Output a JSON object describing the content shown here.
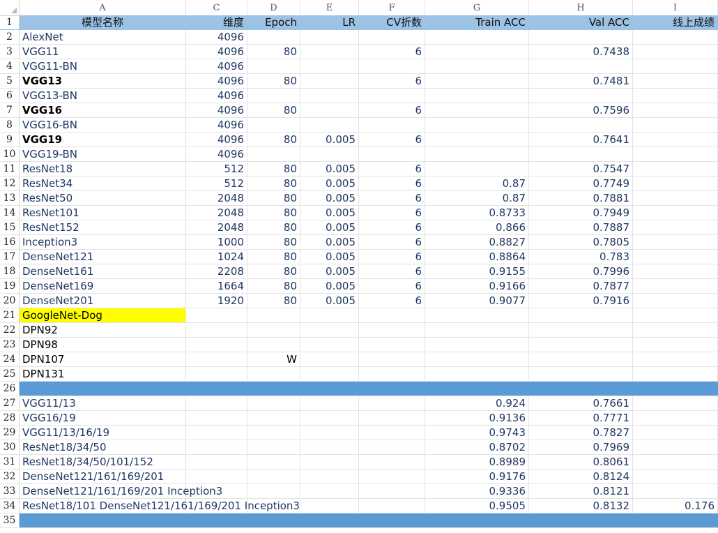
{
  "columns": [
    "A",
    "C",
    "D",
    "E",
    "F",
    "G",
    "H",
    "I"
  ],
  "header": [
    "模型名称",
    "维度",
    "Epoch",
    "LR",
    "CV折数",
    "Train ACC",
    "Val ACC",
    "线上成绩"
  ],
  "rows": [
    {
      "n": "2",
      "A": "AlexNet",
      "C": "4096",
      "D": "",
      "E": "",
      "F": "",
      "G": "",
      "H": "",
      "I": ""
    },
    {
      "n": "3",
      "A": "VGG11",
      "C": "4096",
      "D": "80",
      "E": "",
      "F": "6",
      "G": "",
      "H": "0.7438",
      "I": ""
    },
    {
      "n": "4",
      "A": "VGG11-BN",
      "C": "4096",
      "D": "",
      "E": "",
      "F": "",
      "G": "",
      "H": "",
      "I": ""
    },
    {
      "n": "5",
      "A": "VGG13",
      "C": "4096",
      "D": "80",
      "E": "",
      "F": "6",
      "G": "",
      "H": "0.7481",
      "I": ""
    },
    {
      "n": "6",
      "A": "VGG13-BN",
      "C": "4096",
      "D": "",
      "E": "",
      "F": "",
      "G": "",
      "H": "",
      "I": ""
    },
    {
      "n": "7",
      "A": "VGG16",
      "C": "4096",
      "D": "80",
      "E": "",
      "F": "6",
      "G": "",
      "H": "0.7596",
      "I": ""
    },
    {
      "n": "8",
      "A": "VGG16-BN",
      "C": "4096",
      "D": "",
      "E": "",
      "F": "",
      "G": "",
      "H": "",
      "I": ""
    },
    {
      "n": "9",
      "A": "VGG19",
      "C": "4096",
      "D": "80",
      "E": "0.005",
      "F": "6",
      "G": "",
      "H": "0.7641",
      "I": ""
    },
    {
      "n": "10",
      "A": "VGG19-BN",
      "C": "4096",
      "D": "",
      "E": "",
      "F": "",
      "G": "",
      "H": "",
      "I": ""
    },
    {
      "n": "11",
      "A": "ResNet18",
      "C": "512",
      "D": "80",
      "E": "0.005",
      "F": "6",
      "G": "",
      "H": "0.7547",
      "I": ""
    },
    {
      "n": "12",
      "A": "ResNet34",
      "C": "512",
      "D": "80",
      "E": "0.005",
      "F": "6",
      "G": "0.87",
      "H": "0.7749",
      "I": ""
    },
    {
      "n": "13",
      "A": "ResNet50",
      "C": "2048",
      "D": "80",
      "E": "0.005",
      "F": "6",
      "G": "0.87",
      "H": "0.7881",
      "I": ""
    },
    {
      "n": "14",
      "A": "ResNet101",
      "C": "2048",
      "D": "80",
      "E": "0.005",
      "F": "6",
      "G": "0.8733",
      "H": "0.7949",
      "I": ""
    },
    {
      "n": "15",
      "A": "ResNet152",
      "C": "2048",
      "D": "80",
      "E": "0.005",
      "F": "6",
      "G": "0.866",
      "H": "0.7887",
      "I": ""
    },
    {
      "n": "16",
      "A": "Inception3",
      "C": "1000",
      "D": "80",
      "E": "0.005",
      "F": "6",
      "G": "0.8827",
      "H": "0.7805",
      "I": ""
    },
    {
      "n": "17",
      "A": "DenseNet121",
      "C": "1024",
      "D": "80",
      "E": "0.005",
      "F": "6",
      "G": "0.8864",
      "H": "0.783",
      "I": ""
    },
    {
      "n": "18",
      "A": "DenseNet161",
      "C": "2208",
      "D": "80",
      "E": "0.005",
      "F": "6",
      "G": "0.9155",
      "H": "0.7996",
      "I": ""
    },
    {
      "n": "19",
      "A": "DenseNet169",
      "C": "1664",
      "D": "80",
      "E": "0.005",
      "F": "6",
      "G": "0.9166",
      "H": "0.7877",
      "I": ""
    },
    {
      "n": "20",
      "A": "DenseNet201",
      "C": "1920",
      "D": "80",
      "E": "0.005",
      "F": "6",
      "G": "0.9077",
      "H": "0.7916",
      "I": ""
    },
    {
      "n": "21",
      "A": "GoogleNet-Dog",
      "C": "",
      "D": "",
      "E": "",
      "F": "",
      "G": "",
      "H": "",
      "I": ""
    },
    {
      "n": "22",
      "A": "DPN92",
      "C": "",
      "D": "",
      "E": "",
      "F": "",
      "G": "",
      "H": "",
      "I": ""
    },
    {
      "n": "23",
      "A": "DPN98",
      "C": "",
      "D": "",
      "E": "",
      "F": "",
      "G": "",
      "H": "",
      "I": ""
    },
    {
      "n": "24",
      "A": "DPN107",
      "C": "",
      "D": "W",
      "E": "",
      "F": "",
      "G": "",
      "H": "",
      "I": ""
    },
    {
      "n": "25",
      "A": "DPN131",
      "C": "",
      "D": "",
      "E": "",
      "F": "",
      "G": "",
      "H": "",
      "I": ""
    },
    {
      "n": "26",
      "A": "",
      "C": "",
      "D": "",
      "E": "",
      "F": "",
      "G": "",
      "H": "",
      "I": ""
    },
    {
      "n": "27",
      "A": "VGG11/13",
      "C": "",
      "D": "",
      "E": "",
      "F": "",
      "G": "0.924",
      "H": "0.7661",
      "I": ""
    },
    {
      "n": "28",
      "A": "VGG16/19",
      "C": "",
      "D": "",
      "E": "",
      "F": "",
      "G": "0.9136",
      "H": "0.7771",
      "I": ""
    },
    {
      "n": "29",
      "A": "VGG11/13/16/19",
      "C": "",
      "D": "",
      "E": "",
      "F": "",
      "G": "0.9743",
      "H": "0.7827",
      "I": ""
    },
    {
      "n": "30",
      "A": "ResNet18/34/50",
      "C": "",
      "D": "",
      "E": "",
      "F": "",
      "G": "0.8702",
      "H": "0.7969",
      "I": ""
    },
    {
      "n": "31",
      "A": "ResNet18/34/50/101/152",
      "C": "",
      "D": "",
      "E": "",
      "F": "",
      "G": "0.8989",
      "H": "0.8061",
      "I": ""
    },
    {
      "n": "32",
      "A": "DenseNet121/161/169/201",
      "C": "",
      "D": "",
      "E": "",
      "F": "",
      "G": "0.9176",
      "H": "0.8124",
      "I": ""
    },
    {
      "n": "33",
      "A": "DenseNet121/161/169/201 Inception3",
      "C": "",
      "D": "",
      "E": "",
      "F": "",
      "G": "0.9336",
      "H": "0.8121",
      "I": ""
    },
    {
      "n": "34",
      "A": "ResNet18/101 DenseNet121/161/169/201 Inception3",
      "C": "",
      "D": "",
      "E": "",
      "F": "",
      "G": "0.9505",
      "H": "0.8132",
      "I": "0.176"
    },
    {
      "n": "35",
      "A": "",
      "C": "",
      "D": "",
      "E": "",
      "F": "",
      "G": "",
      "H": "",
      "I": ""
    }
  ],
  "separator_rows": [
    "26",
    "35"
  ],
  "highlight_rows": [
    "21"
  ],
  "bold_rows": [
    "5",
    "7",
    "9"
  ],
  "black_text_rows": [
    "22",
    "23",
    "24",
    "25"
  ],
  "colors": {
    "header_fill": "#9cc2e5",
    "separator_fill": "#5b9bd5",
    "highlight_fill": "#ffff00",
    "text": "#1f3864"
  }
}
